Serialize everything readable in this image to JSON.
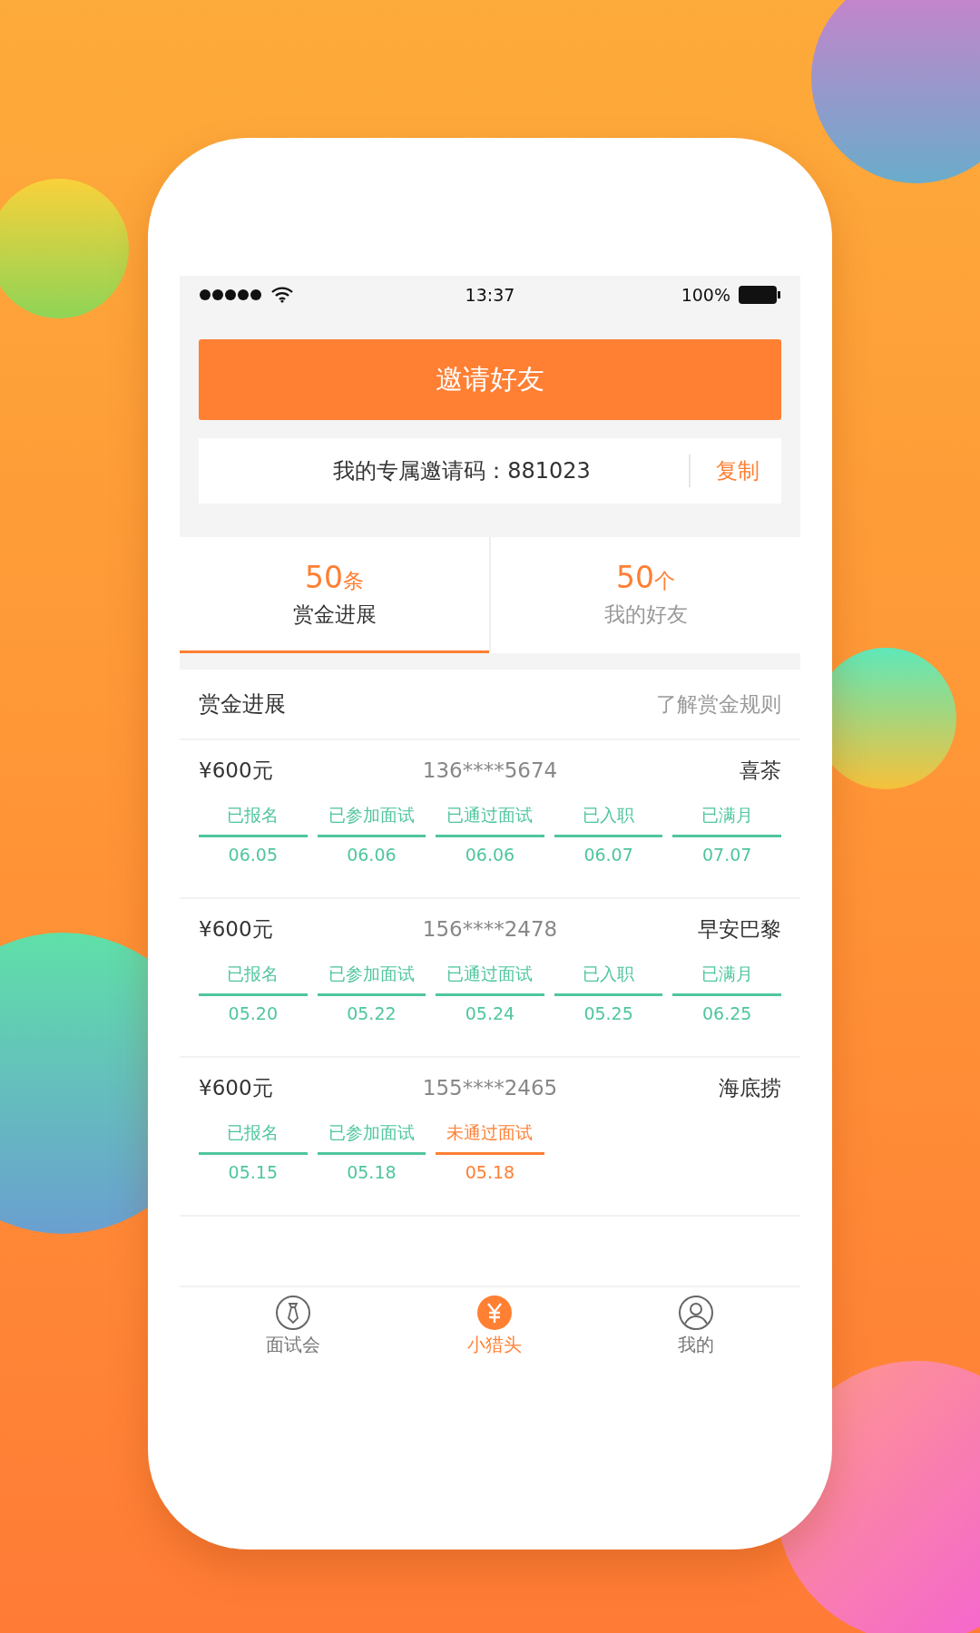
{
  "status_bar": {
    "time": "13:37",
    "battery": "100%"
  },
  "invite_button": {
    "label": "邀请好友"
  },
  "invite_code": {
    "text": "我的专属邀请码：881023",
    "copy": "复制"
  },
  "tabs": [
    {
      "count": "50",
      "unit": "条",
      "label": "赏金进展",
      "selected": true
    },
    {
      "count": "50",
      "unit": "个",
      "label": "我的好友",
      "selected": false
    }
  ],
  "section": {
    "title": "赏金进展",
    "link": "了解赏金规则"
  },
  "records": [
    {
      "amount": "¥600元",
      "phone": "136****5674",
      "company": "喜茶",
      "steps": [
        {
          "label": "已报名",
          "date": "06.05",
          "failed": false
        },
        {
          "label": "已参加面试",
          "date": "06.06",
          "failed": false
        },
        {
          "label": "已通过面试",
          "date": "06.06",
          "failed": false
        },
        {
          "label": "已入职",
          "date": "06.07",
          "failed": false
        },
        {
          "label": "已满月",
          "date": "07.07",
          "failed": false
        }
      ]
    },
    {
      "amount": "¥600元",
      "phone": "156****2478",
      "company": "早安巴黎",
      "steps": [
        {
          "label": "已报名",
          "date": "05.20",
          "failed": false
        },
        {
          "label": "已参加面试",
          "date": "05.22",
          "failed": false
        },
        {
          "label": "已通过面试",
          "date": "05.24",
          "failed": false
        },
        {
          "label": "已入职",
          "date": "05.25",
          "failed": false
        },
        {
          "label": "已满月",
          "date": "06.25",
          "failed": false
        }
      ]
    },
    {
      "amount": "¥600元",
      "phone": "155****2465",
      "company": "海底捞",
      "steps": [
        {
          "label": "已报名",
          "date": "05.15",
          "failed": false
        },
        {
          "label": "已参加面试",
          "date": "05.18",
          "failed": false
        },
        {
          "label": "未通过面试",
          "date": "05.18",
          "failed": true
        }
      ]
    }
  ],
  "tab_bar": [
    {
      "kind": "interview",
      "label": "面试会",
      "selected": false
    },
    {
      "kind": "bounty",
      "label": "小猎头",
      "selected": true
    },
    {
      "kind": "profile",
      "label": "我的",
      "selected": false
    }
  ]
}
